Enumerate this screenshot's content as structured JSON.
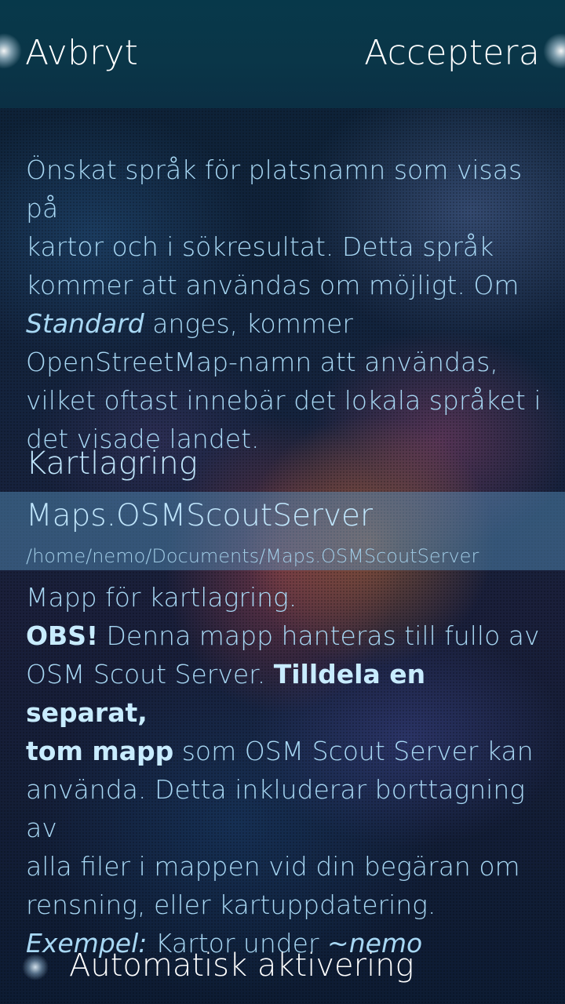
{
  "header": {
    "cancel_label": "Avbryt",
    "accept_label": "Acceptera"
  },
  "language_description": {
    "line1": "Önskat språk för platsnamn som visas på",
    "line2": "kartor och i sökresultat. Detta språk",
    "line3": "kommer att användas om möjligt. Om",
    "line4_em": "Standard",
    "line4_rest": " anges, kommer",
    "line5": "OpenStreetMap-namn att användas,",
    "line6": "vilket oftast innebär det lokala språket i",
    "line7": "det visade landet."
  },
  "storage": {
    "section_title": "Kartlagring",
    "selected_name": "Maps.OSMScoutServer",
    "selected_path": "/home/nemo/Documents/Maps.OSMScoutServer"
  },
  "storage_description": {
    "line1": "Mapp för kartlagring.",
    "obs": "OBS!",
    "line2_rest": " Denna mapp hanteras till fullo av",
    "line3_start": "OSM Scout Server. ",
    "line3_bold": "Tilldela en separat,",
    "line4_bold": "tom mapp",
    "line4_rest": " som OSM Scout Server kan",
    "line5": "använda. Detta inkluderar borttagning av",
    "line6": "alla filer i mappen vid din begäran om",
    "line7": "rensning, eller kartuppdatering.",
    "example_label": "Exempel:",
    "example_text": " Kartor under ",
    "example_path": "~nemo"
  },
  "auto_activation": {
    "label": "Automatisk aktivering"
  }
}
